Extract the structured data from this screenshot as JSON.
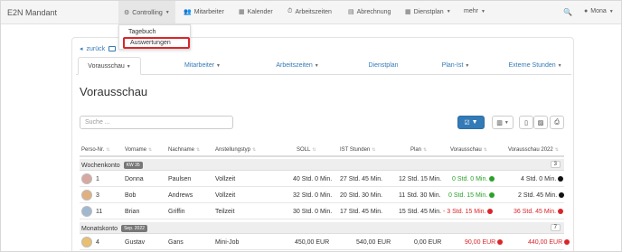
{
  "brand": "E2N Mandant",
  "nav": {
    "controlling": "Controlling",
    "mitarbeiter": "Mitarbeiter",
    "kalender": "Kalender",
    "arbeitszeiten": "Arbeitszeiten",
    "abrechnung": "Abrechnung",
    "dienstplan": "Dienstplan",
    "mehr": "mehr",
    "user": "Mona"
  },
  "dropdown": {
    "item1": "Tagebuch",
    "item2": "Auswertungen"
  },
  "back": "zurück",
  "tabs": [
    "Vorausschau",
    "Mitarbeiter",
    "Arbeitszeiten",
    "Dienstplan",
    "Plan-Ist",
    "Externe Stunden"
  ],
  "title": "Vorausschau",
  "search_placeholder": "Suche ...",
  "columns": [
    "Perso-Nr.",
    "Vorname",
    "Nachname",
    "Anstellungstyp",
    "SOLL",
    "IST Stunden",
    "Plan",
    "Vorausschau",
    "Vorausschau 2022"
  ],
  "groups": [
    {
      "label": "Wochenkonto",
      "badge": "KW 35",
      "count": "3"
    },
    {
      "label": "Monatskonto",
      "badge": "Sep. 2022",
      "count": "7"
    }
  ],
  "rows": [
    {
      "nr": "1",
      "vorname": "Donna",
      "nachname": "Paulsen",
      "typ": "Vollzeit",
      "soll": "40 Std. 0 Min.",
      "ist": "27 Std. 45 Min.",
      "plan": "12 Std. 15 Min.",
      "voraus": "0 Std. 0 Min.",
      "voraus2022": "4 Std. 0 Min."
    },
    {
      "nr": "3",
      "vorname": "Bob",
      "nachname": "Andrews",
      "typ": "Vollzeit",
      "soll": "32 Std. 0 Min.",
      "ist": "20 Std. 30 Min.",
      "plan": "11 Std. 30 Min.",
      "voraus": "0 Std. 15 Min.",
      "voraus2022": "2 Std. 45 Min."
    },
    {
      "nr": "11",
      "vorname": "Brian",
      "nachname": "Griffin",
      "typ": "Teilzeit",
      "soll": "30 Std. 0 Min.",
      "ist": "17 Std. 45 Min.",
      "plan": "15 Std. 45 Min.",
      "voraus": "- 3 Std. 15 Min.",
      "voraus2022": "36 Std. 45 Min."
    },
    {
      "nr": "4",
      "vorname": "Gustav",
      "nachname": "Gans",
      "typ": "Mini-Job",
      "soll": "450,00 EUR",
      "ist": "540,00 EUR",
      "plan": "0,00 EUR",
      "voraus": "90,00 EUR",
      "voraus2022": "440,00 EUR"
    }
  ]
}
